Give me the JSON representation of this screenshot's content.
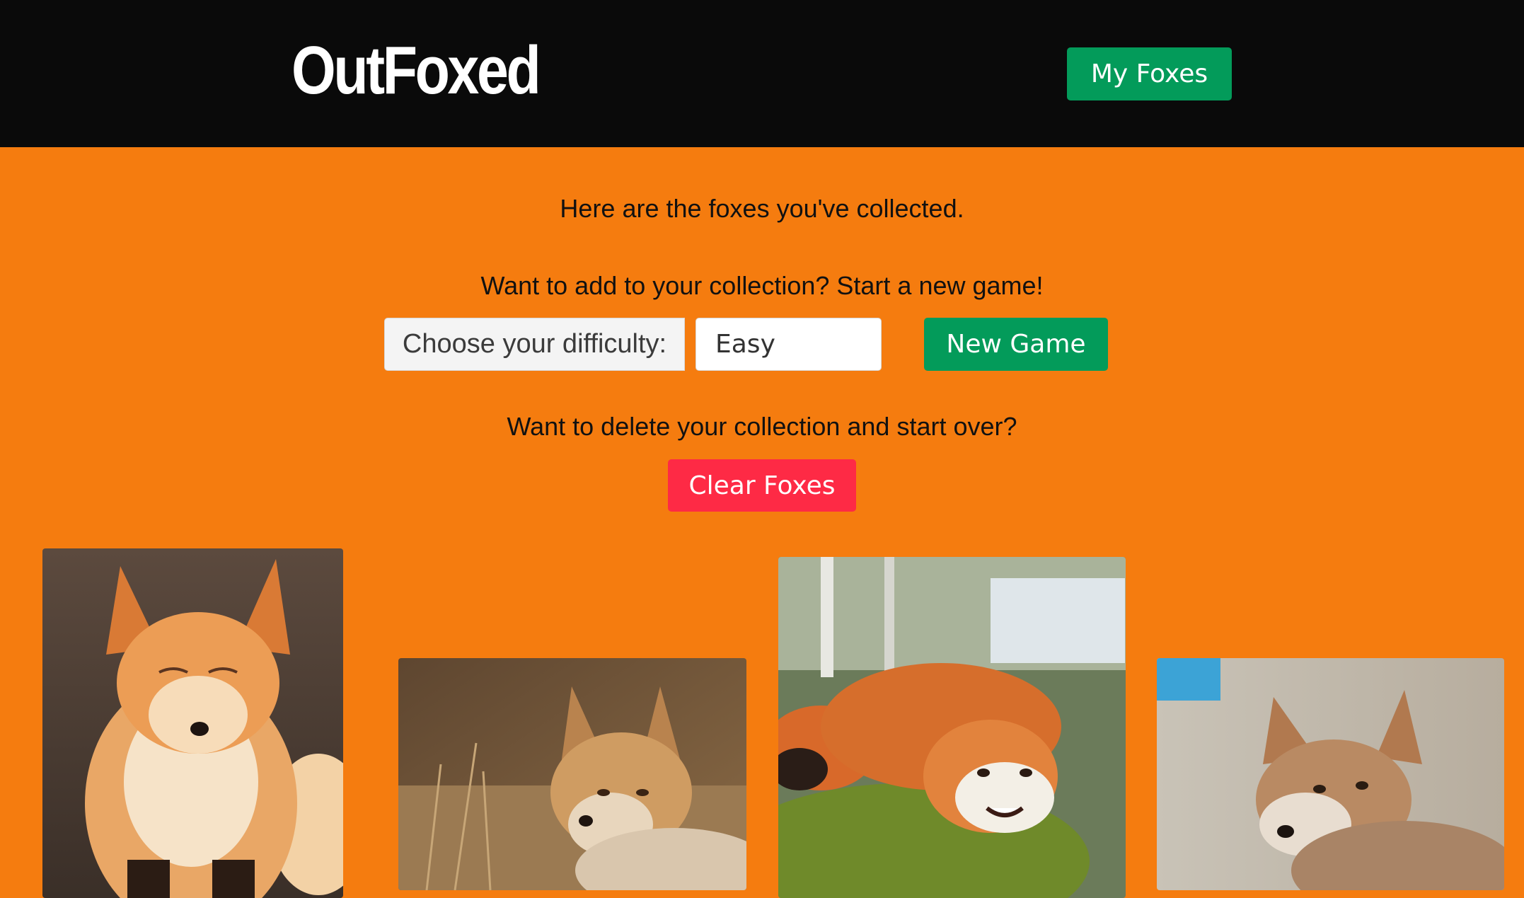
{
  "navbar": {
    "brand": "OutFoxed",
    "my_foxes_label": "My Foxes"
  },
  "main": {
    "collected_text": "Here are the foxes you've collected.",
    "add_text": "Want to add to your collection? Start a new game!",
    "difficulty_label": "Choose your difficulty:",
    "difficulty_value": "Easy",
    "new_game_label": "New Game",
    "delete_text": "Want to delete your collection and start over?",
    "clear_label": "Clear Foxes"
  },
  "colors": {
    "background": "#f57c0f",
    "navbar": "#0a0a0a",
    "green_button": "#039b5a",
    "red_button": "#fe2a45"
  }
}
